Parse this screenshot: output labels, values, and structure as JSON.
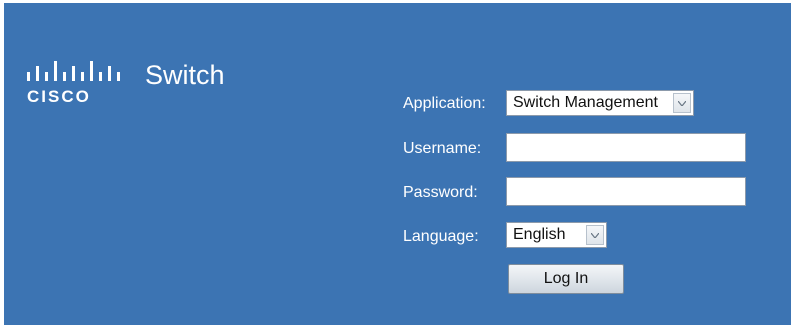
{
  "brand": {
    "logo_icon": "cisco-bridge-logo",
    "logo_word": "CISCO",
    "product_name": "Switch"
  },
  "form": {
    "application": {
      "label": "Application:",
      "value": "Switch Management"
    },
    "username": {
      "label": "Username:",
      "value": ""
    },
    "password": {
      "label": "Password:",
      "value": ""
    },
    "language": {
      "label": "Language:",
      "value": "English"
    },
    "login_label": "Log In"
  },
  "colors": {
    "background": "#3c74b3",
    "text": "#ffffff"
  }
}
